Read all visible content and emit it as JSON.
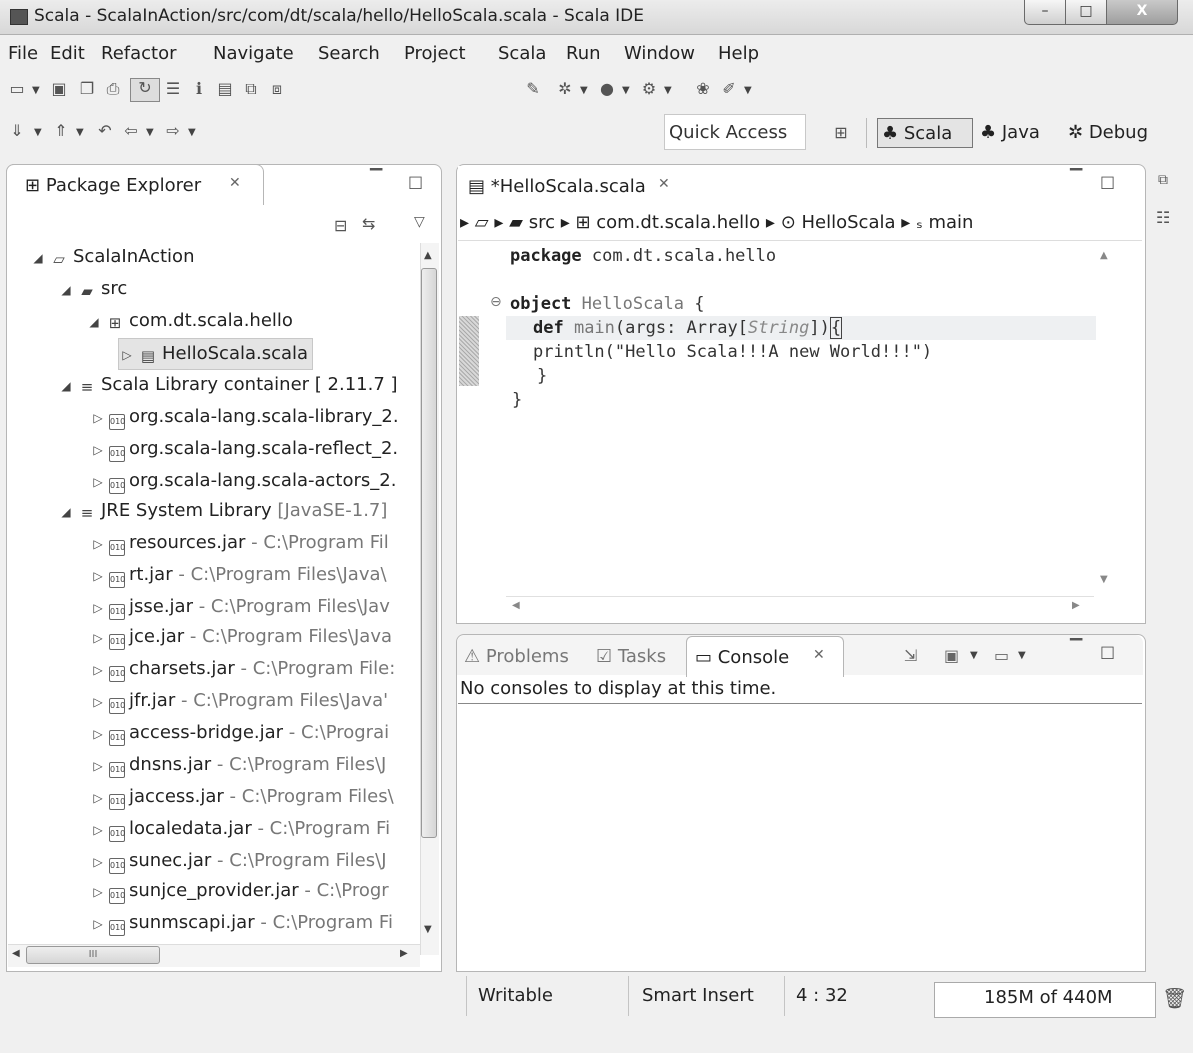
{
  "window": {
    "title": "Scala - ScalaInAction/src/com/dt/scala/hello/HelloScala.scala - Scala IDE",
    "min": "–",
    "max": "□",
    "close": "X"
  },
  "menu": [
    "File",
    "Edit",
    "Refactor",
    "Navigate",
    "Search",
    "Project",
    "Scala",
    "Run",
    "Window",
    "Help"
  ],
  "toolbar": {
    "quick_access": "Quick Access",
    "perspectives": [
      "Scala",
      "Java",
      "Debug"
    ]
  },
  "package_explorer": {
    "tab_label": "Package Explorer",
    "tree": [
      {
        "text": "ScalaInAction",
        "suffix": ""
      },
      {
        "text": "src",
        "suffix": ""
      },
      {
        "text": "com.dt.scala.hello",
        "suffix": ""
      },
      {
        "text": "HelloScala.scala",
        "suffix": ""
      },
      {
        "text": "Scala Library container [ 2.11.7 ]",
        "suffix": ""
      },
      {
        "text": "org.scala-lang.scala-library_2.",
        "suffix": ""
      },
      {
        "text": "org.scala-lang.scala-reflect_2.",
        "suffix": ""
      },
      {
        "text": "org.scala-lang.scala-actors_2.",
        "suffix": ""
      },
      {
        "text": "JRE System Library",
        "suffix": " [JavaSE-1.7]"
      },
      {
        "text": "resources.jar",
        "suffix": " - C:\\Program Fil"
      },
      {
        "text": "rt.jar",
        "suffix": " - C:\\Program Files\\Java\\"
      },
      {
        "text": "jsse.jar",
        "suffix": " - C:\\Program Files\\Jav"
      },
      {
        "text": "jce.jar",
        "suffix": " - C:\\Program Files\\Java"
      },
      {
        "text": "charsets.jar",
        "suffix": " - C:\\Program File:"
      },
      {
        "text": "jfr.jar",
        "suffix": " - C:\\Program Files\\Java'"
      },
      {
        "text": "access-bridge.jar",
        "suffix": " - C:\\Prograi"
      },
      {
        "text": "dnsns.jar",
        "suffix": " - C:\\Program Files\\J"
      },
      {
        "text": "jaccess.jar",
        "suffix": " - C:\\Program Files\\"
      },
      {
        "text": "localedata.jar",
        "suffix": " - C:\\Program Fi"
      },
      {
        "text": "sunec.jar",
        "suffix": " - C:\\Program Files\\J"
      },
      {
        "text": "sunjce_provider.jar",
        "suffix": " - C:\\Progr"
      },
      {
        "text": "sunmscapi.jar",
        "suffix": " - C:\\Program Fi"
      }
    ],
    "hscroll_label": "III"
  },
  "editor": {
    "tab_label": "*HelloScala.scala",
    "breadcrumb": [
      "src",
      "com.dt.scala.hello",
      "HelloScala",
      "main"
    ],
    "code": {
      "l1_kw": "package",
      "l1_rest": " com.dt.scala.hello",
      "l3_kw": "object",
      "l3_name": " HelloScala",
      "l3_rest": " {",
      "l4_kw": "def",
      "l4_name": " main",
      "l4_a": "(args: Array[",
      "l4_type": "String",
      "l4_b": "])",
      "l4_c": "{",
      "l5": "println(\"Hello Scala!!!A new World!!!\")",
      "l6": "}",
      "l7": "}"
    }
  },
  "console_view": {
    "tabs": [
      "Problems",
      "Tasks",
      "Console"
    ],
    "message": "No consoles to display at this time."
  },
  "status_bar": {
    "mode": "Writable",
    "insert": "Smart Insert",
    "position": "4 : 32",
    "heap": "185M of 440M"
  }
}
